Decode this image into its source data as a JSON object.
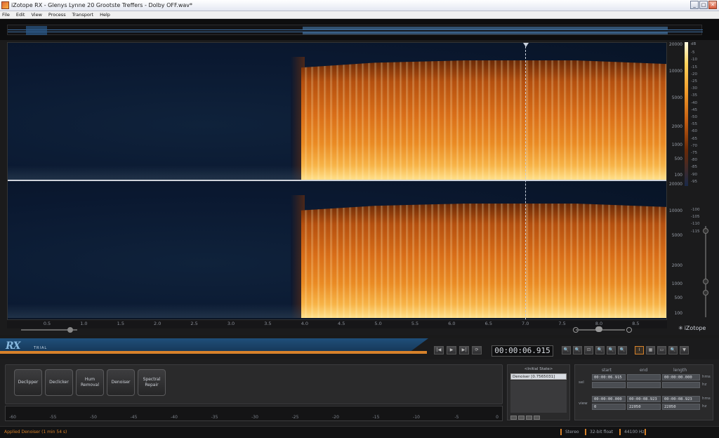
{
  "window": {
    "title": "iZotope RX - Glenys Lynne 20 Grootste Treffers - Dolby OFF.wav*",
    "minimize": "_",
    "maximize": "□",
    "close": "✕"
  },
  "menu": [
    "File",
    "Edit",
    "View",
    "Process",
    "Transport",
    "Help"
  ],
  "time_ruler": {
    "labels": [
      "0.5",
      "1.0",
      "1.5",
      "2.0",
      "2.5",
      "3.0",
      "3.5",
      "4.0",
      "4.5",
      "5.0",
      "5.5",
      "6.0",
      "6.5",
      "7.0",
      "7.5",
      "8.0",
      "8.5"
    ]
  },
  "freq_scale": {
    "left": [
      "20000",
      "10000",
      "5000",
      "2000",
      "1000",
      "500",
      "100"
    ],
    "right": [
      "20000",
      "10000",
      "5000",
      "2000",
      "1000",
      "500",
      "100"
    ],
    "unit": "Hz"
  },
  "db_scale": [
    "dB",
    "-5",
    "-10",
    "-15",
    "-20",
    "-25",
    "-30",
    "-35",
    "-40",
    "-45",
    "-50",
    "-55",
    "-60",
    "-65",
    "-70",
    "-75",
    "-80",
    "-85",
    "-90",
    "-95",
    "-100",
    "-105",
    "-110",
    "-115"
  ],
  "brand": {
    "logo": "RX",
    "edition": "TRIAL",
    "company": "iZotope"
  },
  "transport": {
    "buttons": [
      "|◀",
      "▶",
      "▶|",
      "⟳"
    ],
    "time": "00:00:06.915"
  },
  "tools": [
    "🔍",
    "🔍",
    "⊡",
    "🔍",
    "🔍",
    "🔍",
    "I",
    "▦",
    "▭",
    "🔍",
    "▼"
  ],
  "modules": [
    "Declipper",
    "Declicker",
    "Hum Removal",
    "Denoiser",
    "Spectral Repair"
  ],
  "meter": {
    "labels": [
      "-60",
      "-55",
      "-50",
      "-45",
      "-40",
      "-35",
      "-30",
      "-25",
      "-20",
      "-15",
      "-10",
      "-5",
      "0"
    ]
  },
  "history": {
    "title": "<Initial State>",
    "items": [
      "Denoiser [0.7565031]"
    ]
  },
  "selection": {
    "headers": [
      "start",
      "end",
      "length"
    ],
    "sel_label": "sel",
    "view_label": "view",
    "sel_start": "00:00:06.915",
    "sel_end": "",
    "sel_length": "00:00:00.000",
    "sel_start_hz": "",
    "sel_end_hz": "",
    "sel_length_hz": "",
    "view_start": "00:00:00.000",
    "view_end": "00:00:08.923",
    "view_length": "00:00:08.923",
    "view_start_hz": "0",
    "view_end_hz": "22050",
    "view_length_hz": "22050",
    "unit_time": "hms",
    "unit_hz": "hz"
  },
  "status": {
    "message": "Applied Denoiser (1 min 54 s)",
    "channels": "Stereo",
    "format": "32-bit float",
    "rate": "44100 Hz"
  },
  "colors": {
    "accent": "#d6812a",
    "brand_blue": "#1f4f7a"
  }
}
